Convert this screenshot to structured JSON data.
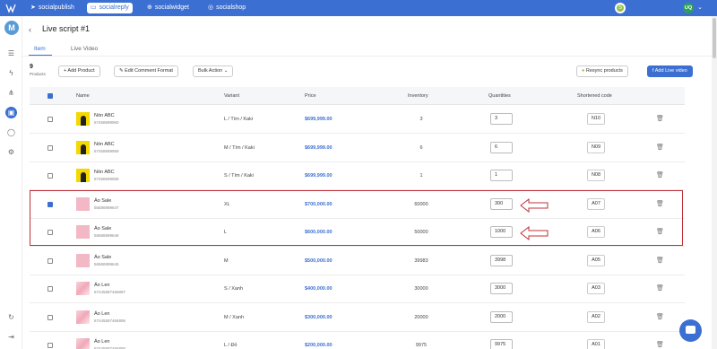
{
  "topnav": {
    "tabs": [
      {
        "label": "socialpublish",
        "icon": "paper-plane-icon"
      },
      {
        "label": "socialreply",
        "icon": "chat-icon"
      },
      {
        "label": "socialwidget",
        "icon": "plus-circle-icon"
      },
      {
        "label": "socialshop",
        "icon": "shopping-bag-icon"
      }
    ],
    "active_tab": "socialreply",
    "user_initials": "UQ",
    "shop_badge_icon": "shopify-icon"
  },
  "sidebar": {
    "avatar_initial": "M",
    "icons": [
      "menu-document-icon",
      "bolt-icon",
      "hierarchy-icon",
      "live-video-icon",
      "user-icon",
      "settings-icon",
      "sync-icon",
      "logout-icon"
    ],
    "active_icon": "live-video-icon"
  },
  "header": {
    "title": "Live script #1",
    "tabs": [
      "Item",
      "Live Video"
    ],
    "active_tab": "Item",
    "count": "9",
    "count_label": "Products"
  },
  "toolbar": {
    "add_product": "+ Add Product",
    "edit_comment_format": "Edit Comment Format",
    "bulk_action": "Bulk Action",
    "resync_products": "Resync products",
    "add_live_video": "Add Live video"
  },
  "table": {
    "columns": [
      "Name",
      "Variant",
      "Price",
      "Inventory",
      "Quantities",
      "Shortened code"
    ],
    "rows": [
      {
        "name": "Nón ABC",
        "sku": "67458699960",
        "variant": "L / Tím / Kaki",
        "price": "$699,999.00",
        "inventory": "3",
        "quantity": "3",
        "code": "N10",
        "checked": false,
        "thumb": "yellow"
      },
      {
        "name": "Nón ABC",
        "sku": "67458699959",
        "variant": "M / Tím / Kaki",
        "price": "$699,999.00",
        "inventory": "6",
        "quantity": "6",
        "code": "N09",
        "checked": false,
        "thumb": "yellow"
      },
      {
        "name": "Nón ABC",
        "sku": "67458699958",
        "variant": "S / Tím / Kaki",
        "price": "$699,999.00",
        "inventory": "1",
        "quantity": "1",
        "code": "N08",
        "checked": false,
        "thumb": "yellow"
      },
      {
        "name": "Áo Sale",
        "sku": "56586999647",
        "variant": "XL",
        "price": "$700,000.00",
        "inventory": "60000",
        "quantity": "300",
        "code": "A07",
        "checked": true,
        "thumb": "pink"
      },
      {
        "name": "Áo Sale",
        "sku": "56586999646",
        "variant": "L",
        "price": "$600,000.00",
        "inventory": "50000",
        "quantity": "1000",
        "code": "A06",
        "checked": false,
        "thumb": "pink"
      },
      {
        "name": "Áo Sale",
        "sku": "56586999645",
        "variant": "M",
        "price": "$500,000.00",
        "inventory": "39983",
        "quantity": "3998",
        "code": "A05",
        "checked": false,
        "thumb": "pink"
      },
      {
        "name": "Áo Len",
        "sku": "67445587466897",
        "variant": "S / Xanh",
        "price": "$400,000.00",
        "inventory": "30000",
        "quantity": "3000",
        "code": "A03",
        "checked": false,
        "thumb": "mixed"
      },
      {
        "name": "Áo Len",
        "sku": "67445587466896",
        "variant": "M / Xanh",
        "price": "$300,000.00",
        "inventory": "20000",
        "quantity": "2000",
        "code": "A02",
        "checked": false,
        "thumb": "mixed"
      },
      {
        "name": "Áo Len",
        "sku": "67445587466895",
        "variant": "L / Đỏ",
        "price": "$200,000.00",
        "inventory": "9975",
        "quantity": "9975",
        "code": "A01",
        "checked": false,
        "thumb": "mixed"
      }
    ]
  },
  "colors": {
    "brand": "#3b6fd1",
    "highlight": "#c0303a",
    "price": "#3b6fd1"
  }
}
